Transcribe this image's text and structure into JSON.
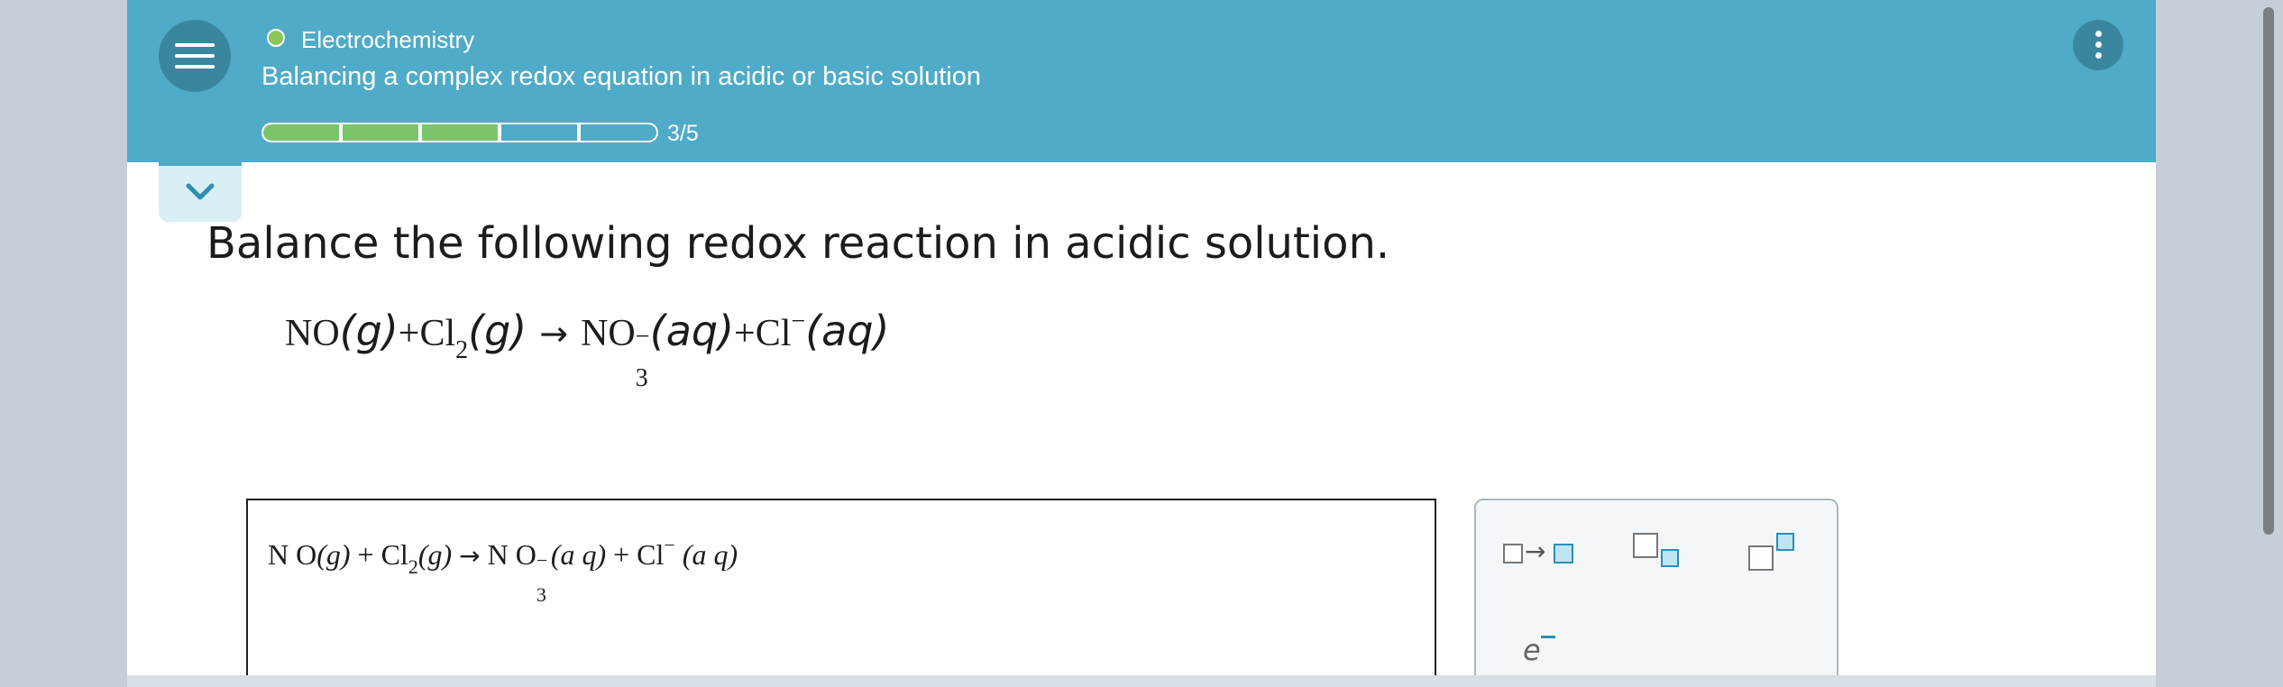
{
  "header": {
    "topic": "Electrochemistry",
    "subtitle": "Balancing a complex redox equation in acidic or basic solution",
    "progress": {
      "completed": 3,
      "total": 5,
      "label": "3/5"
    }
  },
  "question": {
    "prompt": "Balance the following redox reaction in acidic solution.",
    "equation": {
      "r1": "NO",
      "r1_phase": "(g)",
      "plus1": "+",
      "r2": "Cl",
      "r2_sub": "2",
      "r2_phase": "(g)",
      "arrow": "→",
      "p1": "NO",
      "p1_sub": "3",
      "p1_charge": "−",
      "p1_phase": "(aq)",
      "plus2": "+",
      "p2": "Cl",
      "p2_charge": "−",
      "p2_phase": "(aq)"
    }
  },
  "answer": {
    "equation": {
      "r1": "N O",
      "r1_phase": "(g)",
      "plus1": "+",
      "r2": "Cl",
      "r2_sub": "2",
      "r2_phase": "(g)",
      "arrow": "→",
      "p1": "N O",
      "p1_sub": "3",
      "p1_charge": "−",
      "p1_phase": "(a q)",
      "plus2": "+",
      "p2": "Cl",
      "p2_charge": "−",
      "p2_phase": "(a q)"
    }
  },
  "tools": {
    "arrow_glyph": "→",
    "electron": "e",
    "electron_charge": "−"
  },
  "colors": {
    "header": "#4fabc8",
    "header_button": "#3a869f",
    "progress_done": "#7cc36a",
    "topic_dot": "#8ac65a",
    "tool_accent": "#2b8fb3"
  },
  "icons": [
    "menu-icon",
    "more-vertical-icon",
    "chevron-down-icon"
  ]
}
